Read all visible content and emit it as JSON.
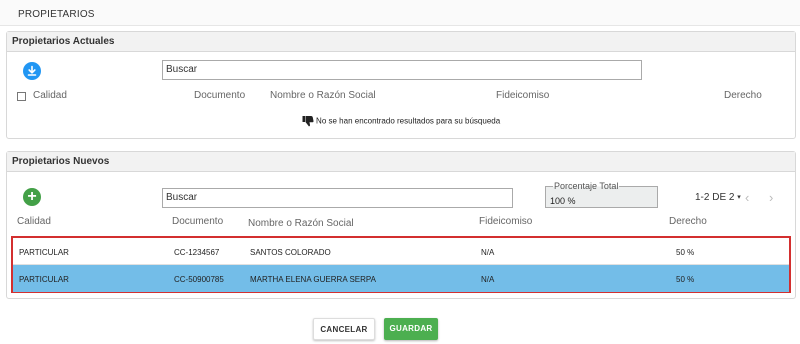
{
  "page": {
    "title": "PROPIETARIOS"
  },
  "actuales": {
    "title": "Propietarios Actuales",
    "search_placeholder": "Buscar",
    "columns": [
      "Calidad",
      "Documento",
      "Nombre o Razón Social",
      "Fideicomiso",
      "Derecho"
    ],
    "empty_message": "No se han encontrado resultados para su búsqueda"
  },
  "nuevos": {
    "title": "Propietarios Nuevos",
    "search_placeholder": "Buscar",
    "percentage_label": "Porcentaje Total",
    "percentage_value": "100 %",
    "pagination": "1-2 DE 2",
    "columns": [
      "Calidad",
      "Documento",
      "Nombre o Razón Social",
      "Fideicomiso",
      "Derecho"
    ],
    "rows": [
      {
        "calidad": "PARTICULAR",
        "documento": "CC-1234567",
        "nombre": "SANTOS COLORADO",
        "fideicomiso": "N/A",
        "derecho": "50 %",
        "selected": false
      },
      {
        "calidad": "PARTICULAR",
        "documento": "CC-50900785",
        "nombre": "MARTHA ELENA GUERRA SERPA",
        "fideicomiso": "N/A",
        "derecho": "50 %",
        "selected": true
      }
    ]
  },
  "actions": {
    "cancel": "CANCELAR",
    "save": "GUARDAR"
  },
  "icons": {
    "download": "download-icon",
    "add": "add-icon",
    "empty": "thumbs-down-icon",
    "caret": "caret-down-icon",
    "prev": "chevron-left-icon",
    "next": "chevron-right-icon"
  },
  "colors": {
    "primary_blue": "#2196f3",
    "add_green": "#43a047",
    "save_green": "#4caf50",
    "selected_row": "#73bde8",
    "highlight_border": "#d32f2f"
  }
}
